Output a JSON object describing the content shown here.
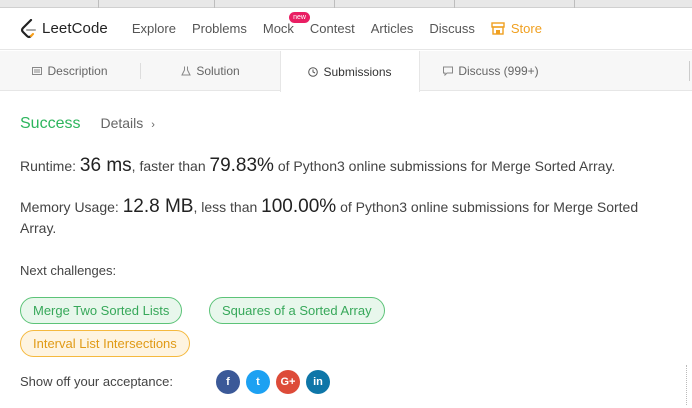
{
  "nav": {
    "logo_text": "LeetCode",
    "items": [
      {
        "label": "Explore"
      },
      {
        "label": "Problems"
      },
      {
        "label": "Mock",
        "badge": "new"
      },
      {
        "label": "Contest"
      },
      {
        "label": "Articles"
      },
      {
        "label": "Discuss"
      },
      {
        "label": "Store"
      }
    ]
  },
  "tabs": [
    {
      "label": "Description",
      "icon": "document-icon"
    },
    {
      "label": "Solution",
      "icon": "flask-icon"
    },
    {
      "label": "Submissions",
      "icon": "clock-icon",
      "active": true
    },
    {
      "label": "Discuss (999+)",
      "icon": "comment-icon"
    }
  ],
  "result": {
    "status": "Success",
    "details_label": "Details",
    "runtime_label": "Runtime:",
    "runtime_value": "36 ms",
    "runtime_mid": ", faster than ",
    "runtime_pct": "79.83%",
    "runtime_tail": " of Python3 online submissions for Merge Sorted Array.",
    "memory_label": "Memory Usage:",
    "memory_value": "12.8 MB",
    "memory_mid": ", less than ",
    "memory_pct": "100.00%",
    "memory_tail": " of Python3 online submissions for Merge Sorted Array."
  },
  "challenges": {
    "label": "Next challenges:",
    "items": [
      {
        "label": "Merge Two Sorted Lists",
        "difficulty": "easy"
      },
      {
        "label": "Squares of a Sorted Array",
        "difficulty": "easy"
      },
      {
        "label": "Interval List Intersections",
        "difficulty": "medium"
      }
    ]
  },
  "share": {
    "label": "Show off your acceptance:",
    "icons": [
      "facebook-icon",
      "twitter-icon",
      "google-plus-icon",
      "linkedin-icon"
    ],
    "glyphs": {
      "facebook": "f",
      "twitter": "t",
      "google_plus": "G+",
      "linkedin": "in"
    }
  },
  "colors": {
    "success": "#2db55d",
    "store": "#f0a020",
    "easy_bg": "#e8f7ec",
    "medium_bg": "#fef4e1"
  }
}
